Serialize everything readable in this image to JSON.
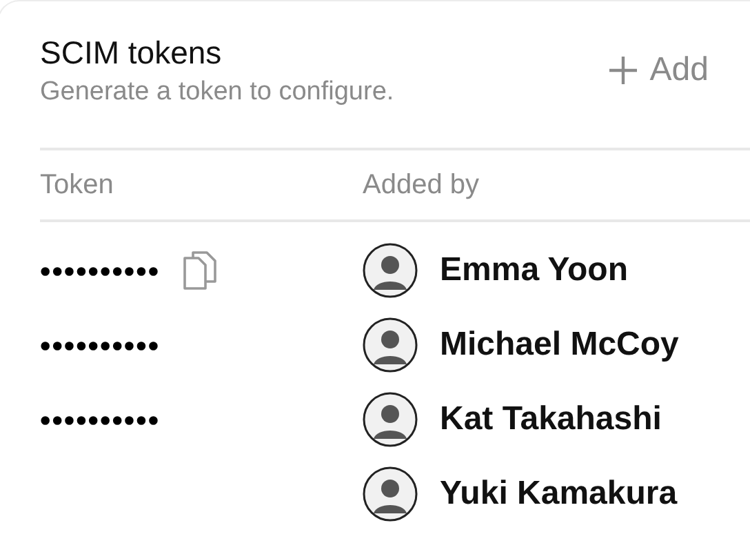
{
  "header": {
    "title": "SCIM tokens",
    "subtitle": "Generate a token to configure.",
    "add_button": "Add"
  },
  "table": {
    "columns": [
      "Token",
      "Added by"
    ],
    "rows": [
      {
        "token": "••••••••••",
        "show_copy": true,
        "added_by": "Emma Yoon"
      },
      {
        "token": "••••••••••",
        "show_copy": false,
        "added_by": "Michael McCoy"
      },
      {
        "token": "••••••••••",
        "show_copy": false,
        "added_by": "Kat Takahashi"
      },
      {
        "show_copy": false,
        "added_by": "Yuki Kamakura"
      }
    ]
  }
}
